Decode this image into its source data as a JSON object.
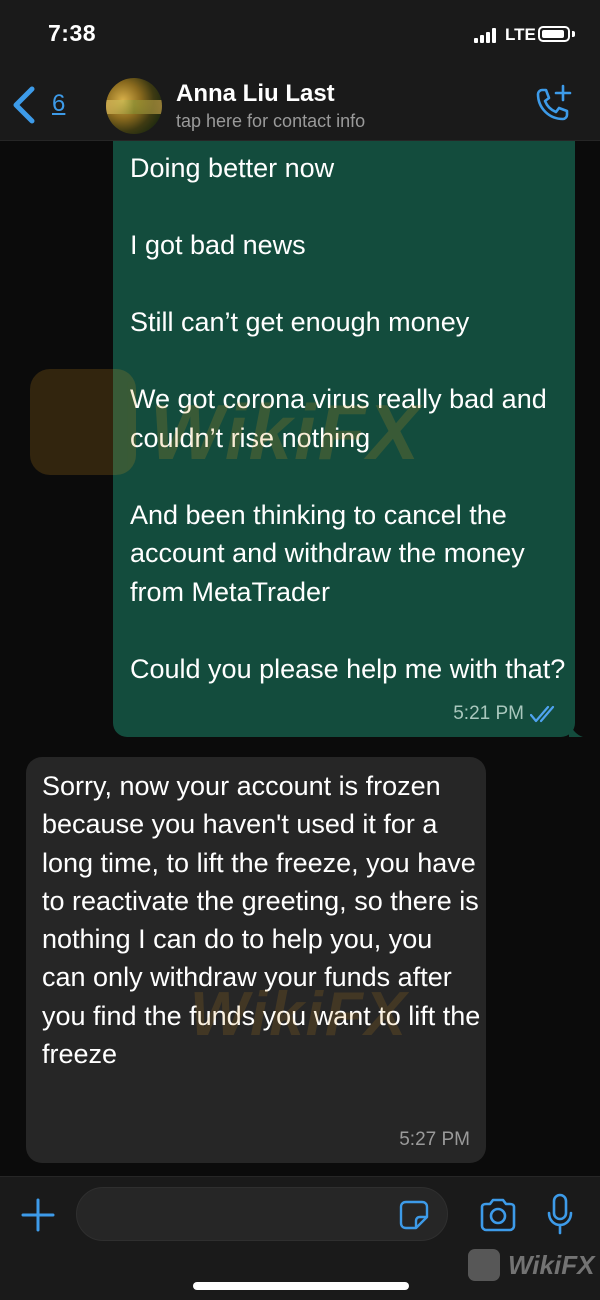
{
  "status_bar": {
    "time": "7:38",
    "network": "LTE"
  },
  "header": {
    "back_count": "6",
    "contact_name": "Anna Liu Last",
    "contact_subtitle": "tap here for contact info",
    "call_icon": "phone-plus-icon"
  },
  "messages": {
    "outgoing": {
      "lines": [
        "Doing better now",
        "I got bad news",
        "Still can’t get enough money",
        "We got corona virus  really bad  and couldn’t rise nothing",
        "And been thinking to cancel the account and withdraw the money from MetaTrader",
        "Could you please help me with that?"
      ],
      "time": "5:21 PM",
      "status_icon": "double-check-icon"
    },
    "incoming": {
      "text": "Sorry, now your account is frozen because you haven't used it for a long time, to lift the freeze, you have to reactivate the greeting, so there is nothing I can do to help you, you can only withdraw your funds after you find the funds you want to lift the freeze",
      "time": "5:27 PM"
    }
  },
  "watermark": {
    "text": "WikiFX"
  },
  "input_bar": {
    "placeholder": ""
  },
  "colors": {
    "accent": "#3d9be9",
    "outgoing_bubble": "#134c3d",
    "incoming_bubble": "#262626",
    "background": "#0b0b0b",
    "watermark": "#e39a1b"
  }
}
